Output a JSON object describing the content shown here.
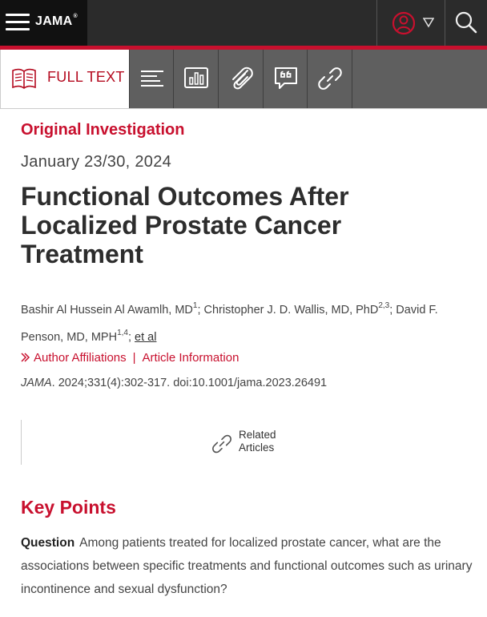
{
  "header": {
    "brand": "JAMA",
    "brand_mark": "®",
    "icons": {
      "menu": "hamburger-menu-icon",
      "user": "user-icon",
      "dropdown": "caret-down-icon",
      "search": "search-icon"
    },
    "colors": {
      "topbar": "#2b2b2b",
      "brand_bg": "#111111",
      "accent": "#c8102e"
    }
  },
  "tabs": {
    "active_label": "FULL TEXT",
    "icons": [
      "book-icon",
      "outline-icon",
      "figures-chart-icon",
      "attachments-paperclip-icon",
      "comments-quote-icon",
      "related-link-icon"
    ]
  },
  "article": {
    "type": "Original Investigation",
    "date": "January 23/30, 2024",
    "title": "Functional Outcomes After Localized Prostate Cancer Treatment",
    "authors": {
      "a1": "Bashir Al Hussein Al Awamlh, MD",
      "a1_sup": "1",
      "a2": "; Christopher J. D. Wallis, MD, PhD",
      "a2_sup": "2,3",
      "a3": "; David F. Penson, MD, MPH",
      "a3_sup": "1,4",
      "sep": "; ",
      "et_al": "et al"
    },
    "affiliations_link": "Author Affiliations",
    "separator": "|",
    "info_link": "Article Information",
    "citation_journal": "JAMA",
    "citation_rest": ". 2024;331(4):302-317. doi:10.1001/jama.2023.26491",
    "related": {
      "line1": "Related",
      "line2": "Articles"
    }
  },
  "key_points": {
    "heading": "Key Points",
    "question_label": "Question",
    "question_text": "Among patients treated for localized prostate cancer, what are the associations between specific treatments and functional outcomes such as urinary incontinence and sexual dysfunction?"
  }
}
